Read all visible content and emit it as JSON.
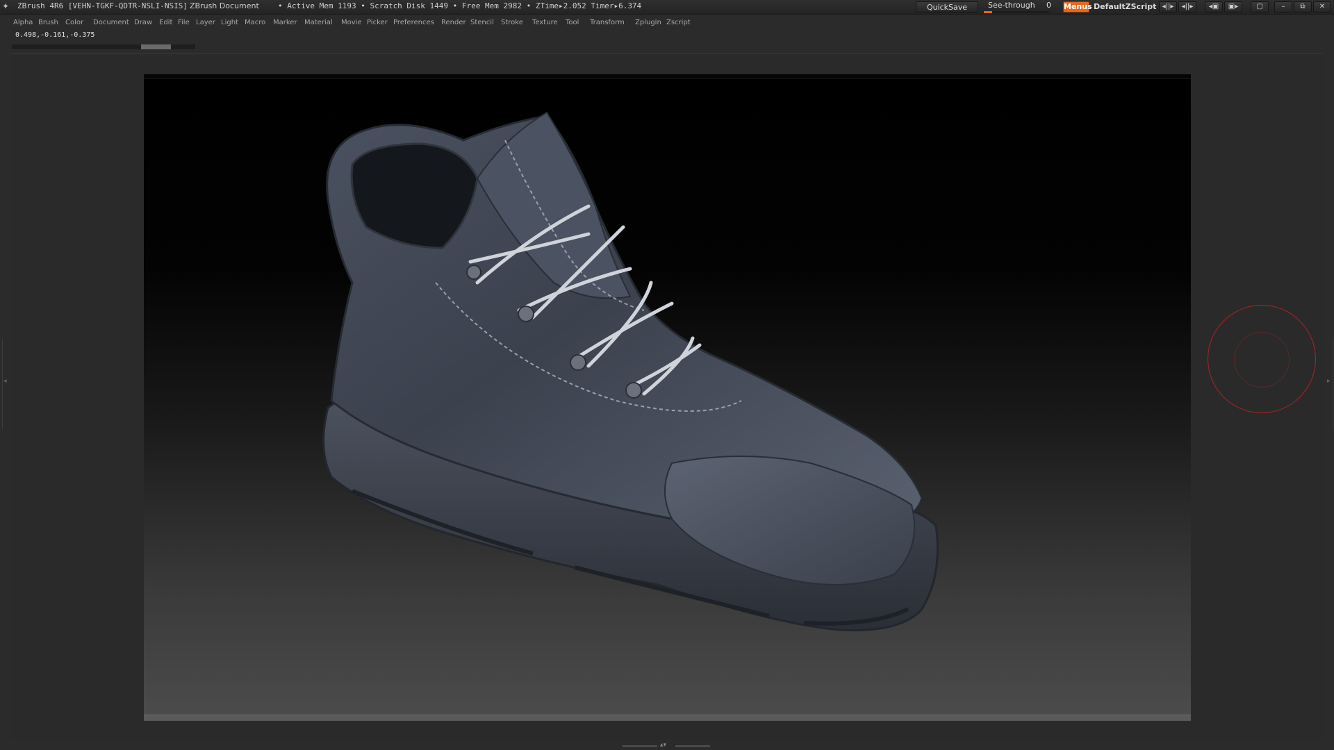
{
  "titlebar": {
    "app_title": "ZBrush 4R6 [VEHN-TGKF-QDTR-NSLI-NSIS]",
    "document_title": "ZBrush Document",
    "stats": "• Active Mem 1193 • Scratch Disk 1449 • Free Mem 2982 • ZTime▸2.052 Timer▸6.374",
    "quicksave_label": "QuickSave",
    "seethrough_label": "See-through",
    "seethrough_value": "0",
    "menus_label": "Menus",
    "default_script_label": "DefaultZScript",
    "accent_color": "#e56a1d"
  },
  "menubar": {
    "items": [
      "Alpha",
      "Brush",
      "Color",
      "Document",
      "Draw",
      "Edit",
      "File",
      "Layer",
      "Light",
      "Macro",
      "Marker",
      "Material",
      "Movie",
      "Picker",
      "Preferences",
      "Render",
      "Stencil",
      "Stroke",
      "Texture",
      "Tool",
      "Transform",
      "Zplugin",
      "Zscript"
    ]
  },
  "status": {
    "coordinates": "0.498,-0.161,-0.375",
    "progress_fraction": 0.16
  },
  "canvas": {
    "subject": "boot-3d-model",
    "brush_cursor_color": "#b32222"
  }
}
